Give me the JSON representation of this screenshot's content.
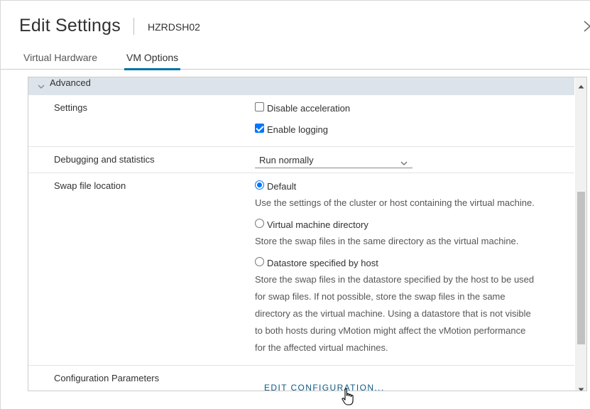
{
  "header": {
    "title": "Edit Settings",
    "vm_name": "HZRDSH02"
  },
  "tabs": [
    {
      "label": "Virtual Hardware",
      "active": false
    },
    {
      "label": "VM Options",
      "active": true
    }
  ],
  "section": {
    "title": "Advanced",
    "expanded": true
  },
  "settings": {
    "label": "Settings",
    "disable_acceleration": {
      "label": "Disable acceleration",
      "checked": false
    },
    "enable_logging": {
      "label": "Enable logging",
      "checked": true
    }
  },
  "debugging": {
    "label": "Debugging and statistics",
    "selected": "Run normally"
  },
  "swap": {
    "label": "Swap file location",
    "options": [
      {
        "label": "Default",
        "checked": true,
        "help": "Use the settings of the cluster or host containing the virtual machine."
      },
      {
        "label": "Virtual machine directory",
        "checked": false,
        "help": "Store the swap files in the same directory as the virtual machine."
      },
      {
        "label": "Datastore specified by host",
        "checked": false,
        "help_lines": [
          "Store the swap files in the datastore specified by the host to be used",
          "for swap files. If not possible, store the swap files in the same",
          "directory as the virtual machine. Using a datastore that is not visible",
          "to both hosts during vMotion might affect the vMotion performance",
          "for the affected virtual machines."
        ]
      }
    ]
  },
  "config_params": {
    "label": "Configuration Parameters",
    "button": "EDIT CONFIGURATION..."
  },
  "colors": {
    "accent": "#0072a3",
    "link": "#0b5a84",
    "section_header_bg": "#dce3ea",
    "checkbox_blue": "#0075ff"
  },
  "icons": {
    "close": "close-icon",
    "section_toggle": "chevron-down-icon",
    "select_caret": "chevron-down-icon",
    "cursor": "hand-pointer-icon"
  }
}
